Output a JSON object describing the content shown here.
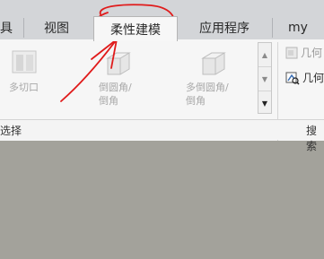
{
  "tabs": [
    {
      "label": "具"
    },
    {
      "label": "视图"
    },
    {
      "label": "柔性建模",
      "selected": true
    },
    {
      "label": "应用程序"
    },
    {
      "label": "my"
    }
  ],
  "ribbon": {
    "buttons": [
      {
        "label": "多切口",
        "icon": "multi-cut-icon",
        "enabled": false
      },
      {
        "label_line1": "倒圆角/",
        "label_line2": "倒角",
        "icon": "round-chamfer-icon",
        "enabled": false
      },
      {
        "label_line1": "多倒圆角/",
        "label_line2": "倒角",
        "icon": "multi-round-chamfer-icon",
        "enabled": false
      }
    ],
    "right_items": [
      {
        "label": "几何",
        "icon": "geometry-icon",
        "enabled": false
      },
      {
        "label": "几何",
        "icon": "geometry-search-icon",
        "enabled": true
      }
    ]
  },
  "groups": {
    "left_label": "选择",
    "right_label": "搜索"
  },
  "colors": {
    "annotation": "#e01b1b",
    "background": "#a3a29b"
  }
}
